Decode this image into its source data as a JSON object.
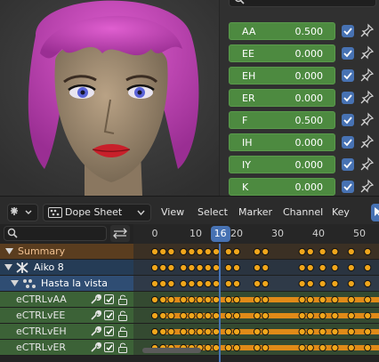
{
  "shape_keys": [
    {
      "name": "AA",
      "value": "0.500"
    },
    {
      "name": "EE",
      "value": "0.000"
    },
    {
      "name": "EH",
      "value": "0.000"
    },
    {
      "name": "ER",
      "value": "0.000"
    },
    {
      "name": "F",
      "value": "0.500"
    },
    {
      "name": "IH",
      "value": "0.000"
    },
    {
      "name": "IY",
      "value": "0.000"
    },
    {
      "name": "K",
      "value": "0.000"
    }
  ],
  "header": {
    "editor_type": "Dope Sheet",
    "menus": [
      "View",
      "Select",
      "Marker",
      "Channel",
      "Key"
    ]
  },
  "timeline": {
    "ruler_ticks": [
      "0",
      "10",
      "20",
      "30",
      "40",
      "50"
    ],
    "current_frame": "16"
  },
  "channels": {
    "summary": "Summary",
    "object": "Aiko 8",
    "action": "Hasta la vista",
    "controls": [
      "eCTRLvAA",
      "eCTRLvEE",
      "eCTRLvEH",
      "eCTRLvER"
    ]
  },
  "colors": {
    "accent": "#4772b3",
    "shape_key_slider": "#4d8a40",
    "keyframe": "#f0a61c",
    "hold_bar": "#e08a18",
    "summary_bg": "#5a3d1f",
    "object_bg": "#253c56",
    "action_bg": "#2f4d73",
    "control_bg": "#3c6237"
  },
  "icons": {
    "viewport_object": "character-head",
    "checkbox": "checkbox-checked-icon",
    "pin": "pin-icon",
    "wrench": "wrench-icon",
    "lock": "lock-icon"
  }
}
